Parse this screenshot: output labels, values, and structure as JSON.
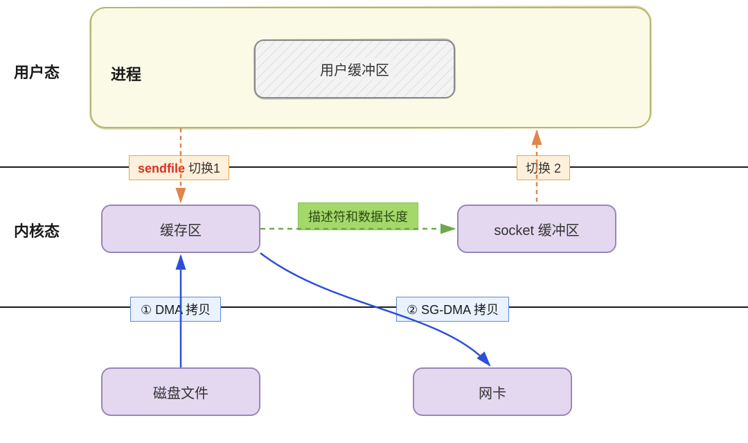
{
  "layers": {
    "user": "用户态",
    "kernel": "内核态"
  },
  "process": {
    "label": "进程",
    "user_buffer": "用户缓冲区"
  },
  "switches": {
    "sendfile_fn": "sendfile",
    "sendfile_suffix": " 切换1",
    "switch2": "切换 2"
  },
  "kernel_boxes": {
    "cache": "缓存区",
    "socket_buf": "socket 缓冲区"
  },
  "edge_labels": {
    "desc_len": "描述符和数据长度",
    "dma": "① DMA 拷贝",
    "sgdma": "② SG-DMA 拷贝"
  },
  "hw_boxes": {
    "disk": "磁盘文件",
    "nic": "网卡"
  }
}
